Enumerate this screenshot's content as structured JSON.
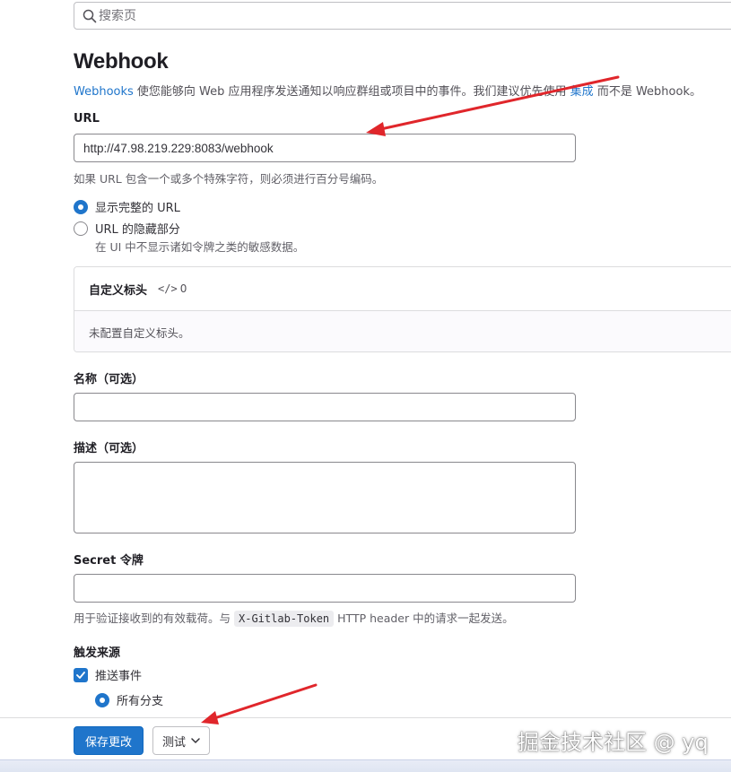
{
  "search": {
    "placeholder": "搜索页"
  },
  "page": {
    "title": "Webhook",
    "intro_link": "Webhooks",
    "intro_text": " 使您能够向 Web 应用程序发送通知以响应群组或项目中的事件。我们建议优先使用 ",
    "intro_link2": "集成",
    "intro_tail": " 而不是 Webhook。"
  },
  "url": {
    "label": "URL",
    "value": "http://47.98.219.229:8083/webhook",
    "help": "如果 URL 包含一个或多个特殊字符，则必须进行百分号编码。",
    "option_full": "显示完整的 URL",
    "option_mask": "URL 的隐藏部分",
    "option_mask_help": "在 UI 中不显示诸如令牌之类的敏感数据。"
  },
  "headers": {
    "title": "自定义标头",
    "count": "0",
    "empty": "未配置自定义标头。"
  },
  "name": {
    "label": "名称（可选）",
    "value": ""
  },
  "description": {
    "label": "描述（可选）",
    "value": ""
  },
  "secret": {
    "label": "Secret 令牌",
    "value": "",
    "help_prefix": "用于验证接收到的有效载荷。与",
    "help_code": "X-Gitlab-Token",
    "help_suffix": "HTTP header 中的请求一起发送。"
  },
  "triggers": {
    "label": "触发来源",
    "push_events": "推送事件",
    "all_branches": "所有分支"
  },
  "footer": {
    "save_label": "保存更改",
    "test_label": "测试"
  },
  "watermark": "掘金技术社区 @ yq",
  "colors": {
    "accent": "#1f75cb",
    "annotation": "#e0262b"
  }
}
